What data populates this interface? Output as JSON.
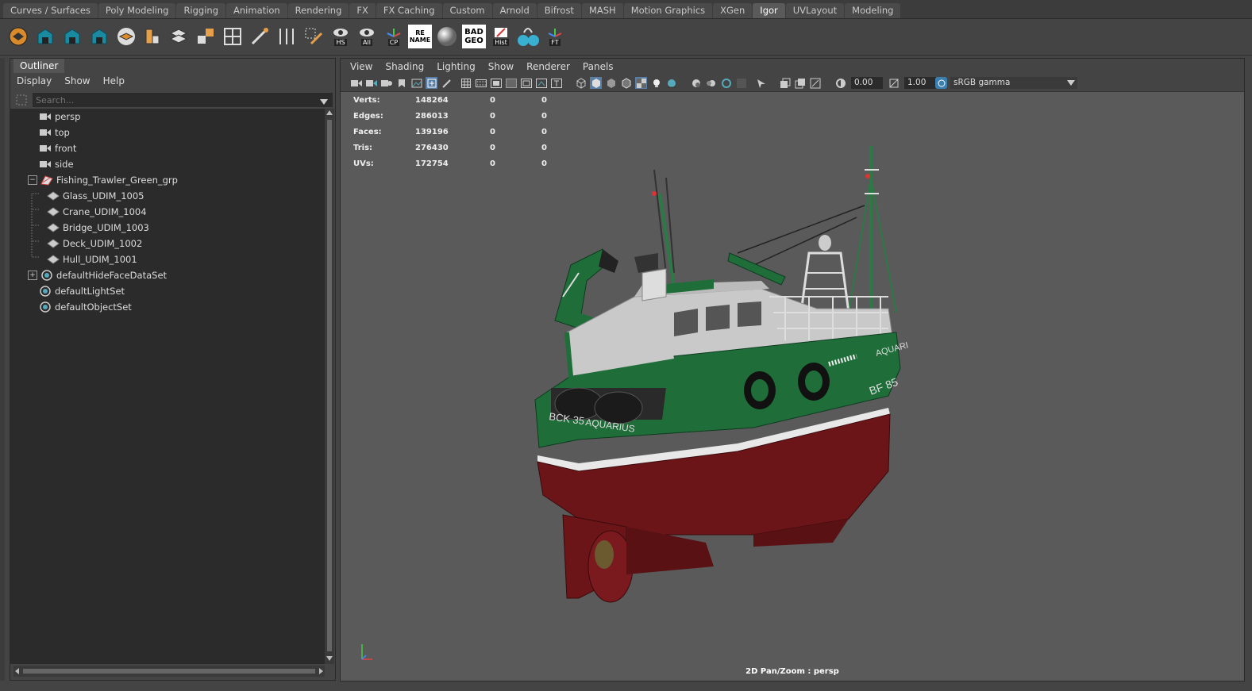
{
  "shelf_tabs": [
    "Curves / Surfaces",
    "Poly Modeling",
    "Rigging",
    "Animation",
    "Rendering",
    "FX",
    "FX Caching",
    "Custom",
    "Arnold",
    "Bifrost",
    "MASH",
    "Motion Graphics",
    "XGen",
    "Igor",
    "UVLayout",
    "Modeling"
  ],
  "active_shelf_tab": "Igor",
  "shelf_labels": {
    "hs": "HS",
    "all": "All",
    "cp": "CP",
    "rename": "RE NAME",
    "badgeo": "BAD GEO",
    "hist": "Hist",
    "ft": "FT"
  },
  "outliner": {
    "tab": "Outliner",
    "menu": [
      "Display",
      "Show",
      "Help"
    ],
    "search_placeholder": "Search...",
    "items": [
      {
        "label": "persp",
        "icon": "camera-icon"
      },
      {
        "label": "top",
        "icon": "camera-icon"
      },
      {
        "label": "front",
        "icon": "camera-icon"
      },
      {
        "label": "side",
        "icon": "camera-icon"
      },
      {
        "label": "Fishing_Trawler_Green_grp",
        "icon": "group-icon"
      },
      {
        "label": "Glass_UDIM_1005",
        "icon": "mesh-icon"
      },
      {
        "label": "Crane_UDIM_1004",
        "icon": "mesh-icon"
      },
      {
        "label": "Bridge_UDIM_1003",
        "icon": "mesh-icon"
      },
      {
        "label": "Deck_UDIM_1002",
        "icon": "mesh-icon"
      },
      {
        "label": "Hull_UDIM_1001",
        "icon": "mesh-icon"
      },
      {
        "label": "defaultHideFaceDataSet",
        "icon": "set-icon"
      },
      {
        "label": "defaultLightSet",
        "icon": "set-icon"
      },
      {
        "label": "defaultObjectSet",
        "icon": "set-icon"
      }
    ]
  },
  "viewport": {
    "menu": [
      "View",
      "Shading",
      "Lighting",
      "Show",
      "Renderer",
      "Panels"
    ],
    "exposure": "0.00",
    "gamma": "1.00",
    "color_space": "sRGB gamma",
    "hud": [
      {
        "label": "Verts:",
        "v1": "148264",
        "v2": "0",
        "v3": "0"
      },
      {
        "label": "Edges:",
        "v1": "286013",
        "v2": "0",
        "v3": "0"
      },
      {
        "label": "Faces:",
        "v1": "139196",
        "v2": "0",
        "v3": "0"
      },
      {
        "label": "Tris:",
        "v1": "276430",
        "v2": "0",
        "v3": "0"
      },
      {
        "label": "UVs:",
        "v1": "172754",
        "v2": "0",
        "v3": "0"
      }
    ],
    "footer": "2D Pan/Zoom : persp",
    "boat_text": {
      "port": "BCK 35",
      "name": "AQUARIUS",
      "side": "BF 85",
      "bow": "AQUARI"
    }
  },
  "colors": {
    "hull_red": "#6b1519",
    "hull_green": "#1f6e3a",
    "cabin_white": "#c9c9c9",
    "viewport_bg": "#5a5a5a"
  }
}
